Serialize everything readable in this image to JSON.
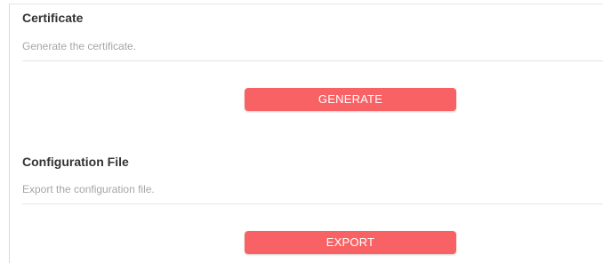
{
  "certificate": {
    "title": "Certificate",
    "description": "Generate the certificate.",
    "button_label": "GENERATE"
  },
  "configuration_file": {
    "title": "Configuration File",
    "description": "Export the configuration file.",
    "button_label": "EXPORT"
  },
  "colors": {
    "button_background": "#f96264",
    "button_text": "#ffffff",
    "title_text": "#333333",
    "description_text": "#a6a6a6",
    "divider": "#e4e4e4"
  }
}
